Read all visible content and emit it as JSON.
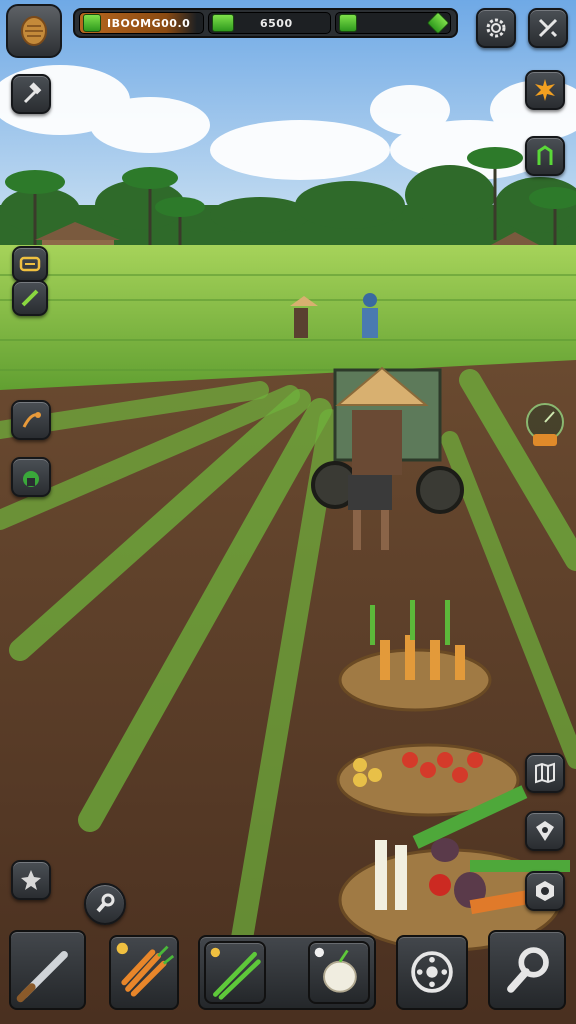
{
  "hud": {
    "resource_primary": "IBOOMG00.0",
    "resource_secondary": "6500",
    "resource_tertiary": ""
  },
  "icons": {
    "top_left": "rice-seed-icon",
    "settings": "gear-icon",
    "close": "crossed-tools-icon",
    "build": "hammer-icon",
    "event": "star-burst-icon",
    "crop": "leaf-icon",
    "chat": "chat-icon",
    "edit": "pencil-icon",
    "harvest": "harvest-icon",
    "seed": "seed-sprout-icon",
    "progress": "progress-dial-icon",
    "map": "map-icon",
    "shield": "shield-icon",
    "storage": "storage-icon",
    "skill": "skill-icon",
    "sickle": "sickle-icon",
    "carrots": "carrot-bundle-icon",
    "onions": "green-onion-icon",
    "bulb": "onion-bulb-icon",
    "gear_tool": "wheel-icon",
    "wrench": "wrench-icon"
  },
  "colors": {
    "sky": "#8fc3ee",
    "field": "#7fbe45",
    "soil": "#5b3d28",
    "hud_dark": "#2b2f33",
    "resource_orange": "#b8671f",
    "gem_green": "#5ac832"
  }
}
